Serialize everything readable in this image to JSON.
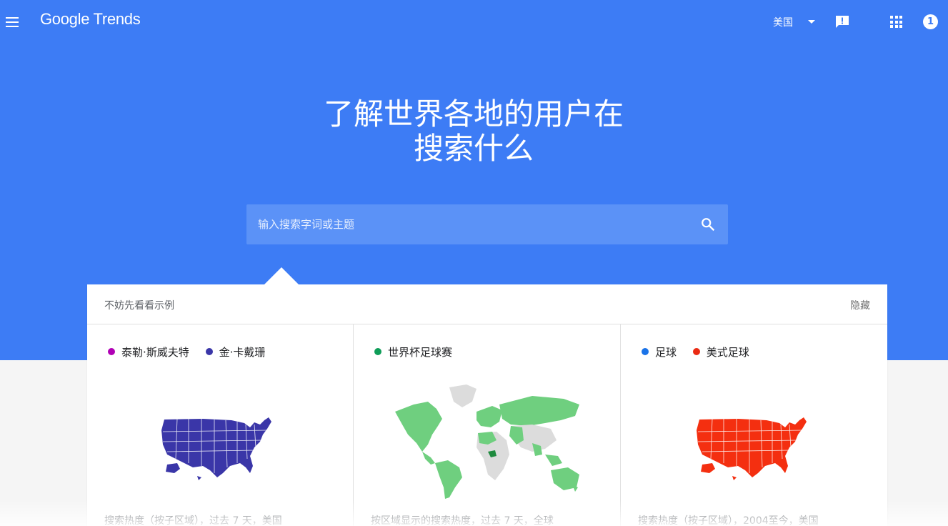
{
  "app": {
    "logo_text": "Google Trends",
    "region": "美国",
    "account_badge": "1"
  },
  "hero": {
    "headline_line1": "了解世界各地的用户在",
    "headline_line2": "搜索什么",
    "search_placeholder": "输入搜索字词或主题"
  },
  "examples": {
    "title": "不妨先看看示例",
    "hide_label": "隐藏",
    "cards": [
      {
        "legend": [
          {
            "label": "泰勒·斯威夫特",
            "color": "#b000b5"
          },
          {
            "label": "金·卡戴珊",
            "color": "#3a36a8"
          }
        ],
        "map_color": "#3a36a8",
        "caption": "搜索热度（按子区域），过去 7 天，美国"
      },
      {
        "legend": [
          {
            "label": "世界杯足球赛",
            "color": "#0f9d58"
          }
        ],
        "map_color": "#6fcf7f",
        "caption": "按区域显示的搜索热度，过去 7 天，全球"
      },
      {
        "legend": [
          {
            "label": "足球",
            "color": "#1a73e8"
          },
          {
            "label": "美式足球",
            "color": "#ea2a12"
          }
        ],
        "map_color": "#f42f10",
        "caption": "搜索热度（按子区域），2004至今，美国"
      }
    ]
  },
  "colors": {
    "brand_blue": "#3d7cf5",
    "search_box": "#5b92f7"
  }
}
